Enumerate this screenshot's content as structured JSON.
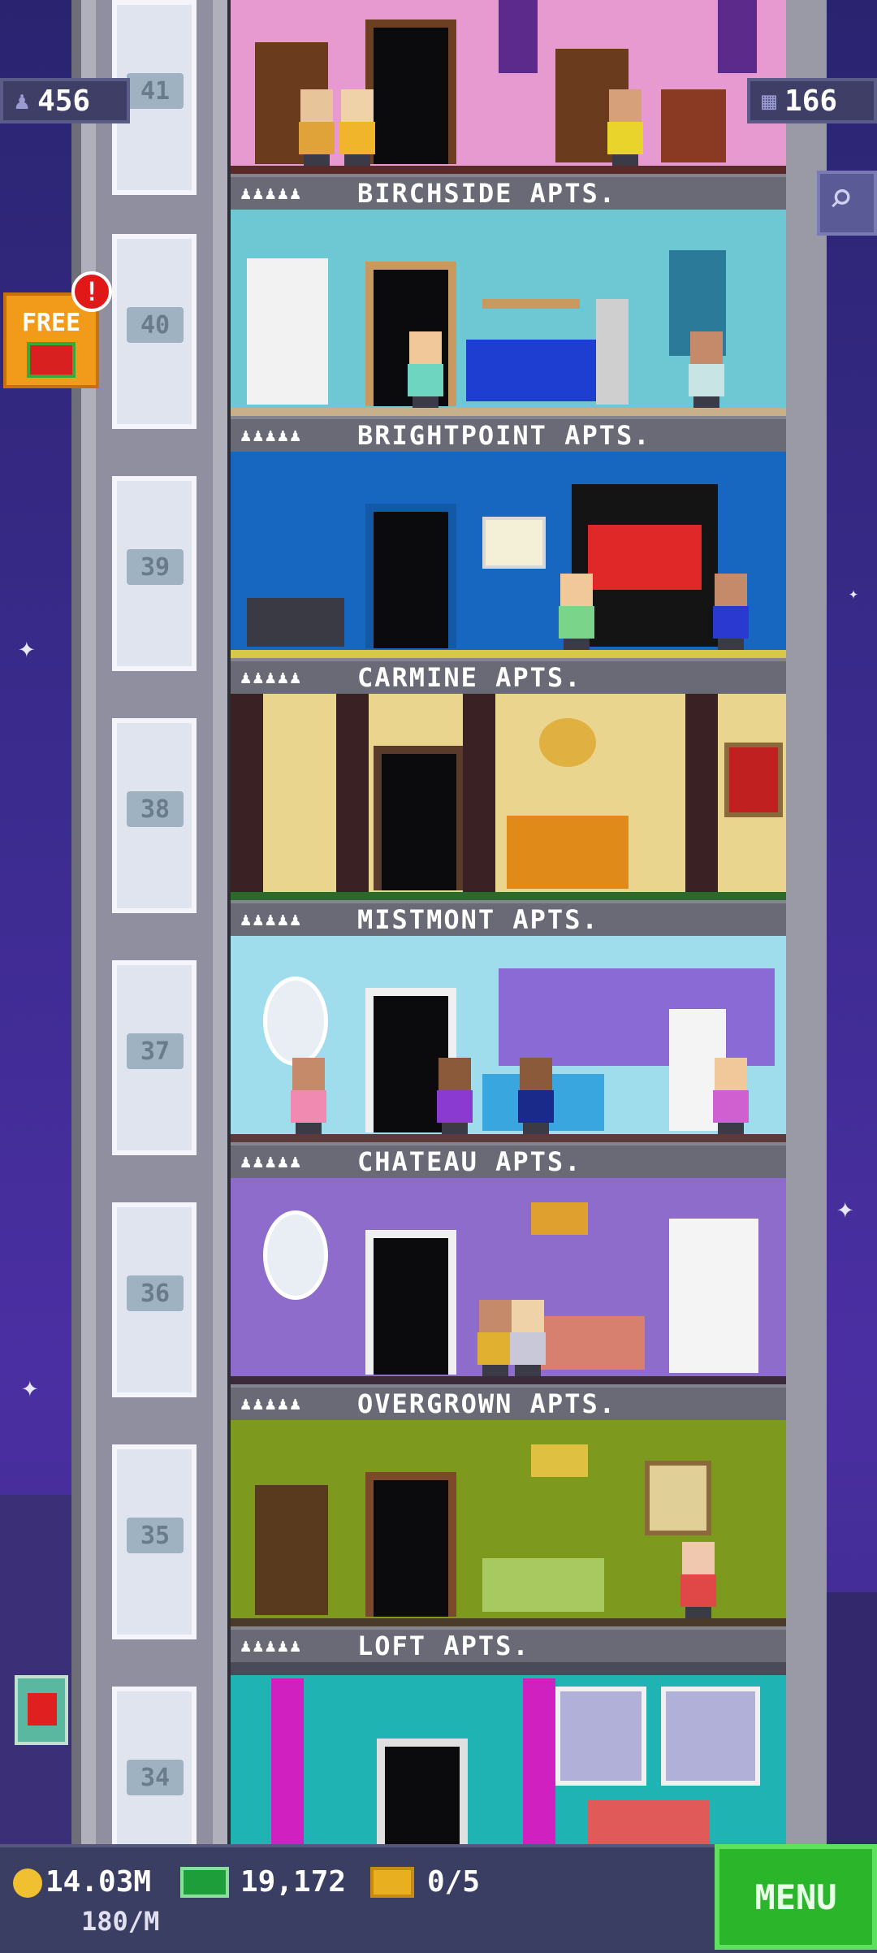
{
  "hud": {
    "population": "456",
    "floors": "166",
    "free_label": "FREE",
    "alert_mark": "!",
    "search_icon": "magnifier-icon"
  },
  "floors": [
    {
      "number": "41",
      "name": "BIRCHSIDE APTS.",
      "label_bar_visible": true,
      "theme": "#e79ad0"
    },
    {
      "number": "40",
      "name": "BRIGHTPOINT APTS.",
      "theme": "#6ec8d4"
    },
    {
      "number": "39",
      "name": "CARMINE APTS.",
      "theme": "#1766c0"
    },
    {
      "number": "38",
      "name": "MISTMONT APTS.",
      "theme": "#e9d58e"
    },
    {
      "number": "37",
      "name": "CHATEAU APTS.",
      "theme": "#9fdcec"
    },
    {
      "number": "36",
      "name": "OVERGROWN APTS.",
      "theme": "#8d6ccc"
    },
    {
      "number": "35",
      "name": "LOFT APTS.",
      "theme": "#7e9a1e"
    },
    {
      "number": "34",
      "name": "",
      "theme": "#1fb3b3"
    }
  ],
  "occupancy_icons": "♟♟♟♟♟",
  "bottom": {
    "coins": "14.03M",
    "coin_rate": "180/M",
    "bux": "19,172",
    "tickets": "0/5",
    "menu_label": "MENU"
  },
  "colors": {
    "accent_green": "#2bb52b",
    "hud_bg": "#3e3e66"
  }
}
